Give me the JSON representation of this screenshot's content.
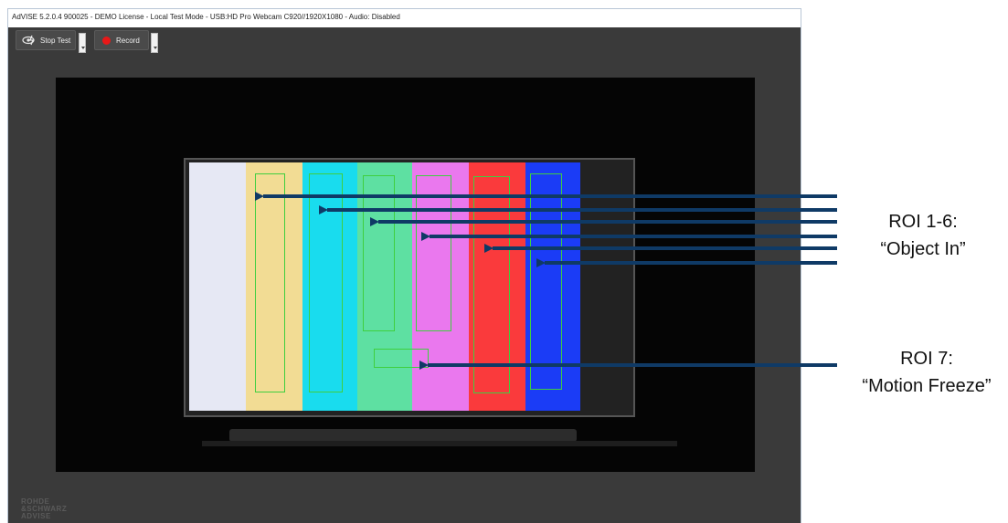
{
  "window": {
    "title": "AdVISE 5.2.0.4 900025 - DEMO License - Local Test Mode - USB:HD Pro Webcam C920//1920X1080 - Audio: Disabled"
  },
  "toolbar": {
    "stop_test_label": "Stop Test",
    "record_label": "Record"
  },
  "video": {
    "bar_colors": [
      "#e6e8f4",
      "#f2dc94",
      "#19dcee",
      "#5ee0a2",
      "#ea78ee",
      "#fa3a3c",
      "#1b3cf6"
    ]
  },
  "logo": {
    "lines": [
      "ROHDE",
      "&SCHWARZ",
      "ADVISE"
    ]
  },
  "annotations": {
    "roi_1_6_title": "ROI 1-6:",
    "roi_1_6_desc": "“Object In”",
    "roi_7_title": "ROI 7:",
    "roi_7_desc": "“Motion Freeze”"
  },
  "colors": {
    "arrow": "#0f3a66",
    "roi_box": "#3fcf3f",
    "record_dot": "#e81818"
  }
}
